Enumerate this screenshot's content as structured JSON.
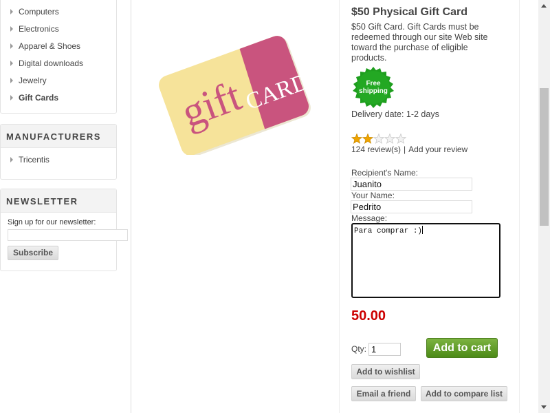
{
  "categories": {
    "items": [
      {
        "label": "Computers",
        "active": false
      },
      {
        "label": "Electronics",
        "active": false
      },
      {
        "label": "Apparel & Shoes",
        "active": false
      },
      {
        "label": "Digital downloads",
        "active": false
      },
      {
        "label": "Jewelry",
        "active": false
      },
      {
        "label": "Gift Cards",
        "active": true
      }
    ]
  },
  "manufacturers": {
    "title": "MANUFACTURERS",
    "items": [
      "Tricentis"
    ]
  },
  "newsletter": {
    "title": "NEWSLETTER",
    "label": "Sign up for our newsletter:",
    "input_value": "",
    "subscribe_label": "Subscribe"
  },
  "product": {
    "image_text_gift": "gift",
    "image_text_card": "CARD",
    "title": "$50 Physical Gift Card",
    "description": "$50 Gift Card. Gift Cards must be redeemed through our site Web site toward the purchase of eligible products.",
    "free_shipping_line1": "Free",
    "free_shipping_line2": "shipping",
    "delivery": "Delivery date: 1-2 days",
    "rating": 2,
    "rating_max": 5,
    "reviews_count": "124 review(s)",
    "reviews_sep": "|",
    "add_review": "Add your review",
    "recipient_label": "Recipient's Name:",
    "recipient_value": "Juanito",
    "your_name_label": "Your Name:",
    "your_name_value": "Pedrito",
    "message_label": "Message:",
    "message_value": "Para comprar :)",
    "price": "50.00",
    "qty_label": "Qty:",
    "qty_value": "1",
    "add_to_cart": "Add to cart",
    "add_to_wishlist": "Add to wishlist",
    "email_friend": "Email a friend",
    "add_to_compare": "Add to compare list"
  },
  "colors": {
    "price": "#cc0000",
    "add_to_cart": "#5a9a1f",
    "free_shipping": "#1e9e1e",
    "card_pink": "#c9547e",
    "card_yellow": "#f6e39a",
    "star": "#f0a400"
  }
}
